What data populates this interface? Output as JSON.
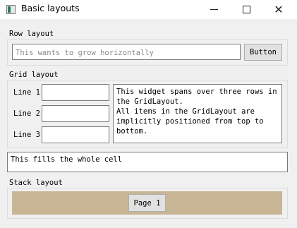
{
  "window": {
    "title": "Basic layouts",
    "controls": {
      "minimize": "minimize-icon",
      "maximize": "maximize-icon",
      "close": "close-icon"
    }
  },
  "row_layout": {
    "title": "Row layout",
    "input_placeholder": "This wants to grow horizontally",
    "button_label": "Button"
  },
  "grid_layout": {
    "title": "Grid layout",
    "lines": [
      {
        "label": "Line 1",
        "value": ""
      },
      {
        "label": "Line 2",
        "value": ""
      },
      {
        "label": "Line 3",
        "value": ""
      }
    ],
    "text_edit": "This widget spans over three rows in the GridLayout.\nAll items in the GridLayout are implicitly positioned from top to bottom."
  },
  "fill_text": "This fills the whole cell",
  "stack_layout": {
    "title": "Stack layout",
    "page_button": "Page 1",
    "background": "#c8b595"
  }
}
